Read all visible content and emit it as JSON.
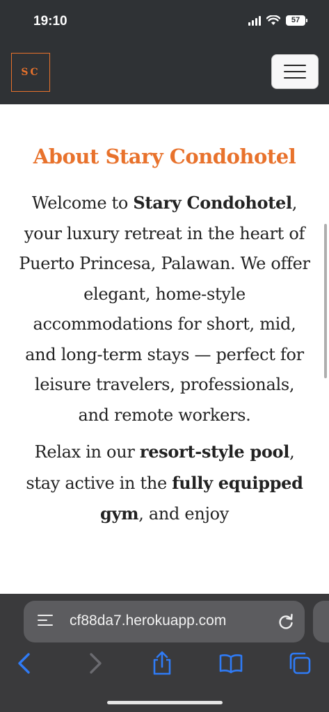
{
  "status_bar": {
    "time": "19:10",
    "battery": "57"
  },
  "navbar": {
    "logo_text": "SC"
  },
  "content": {
    "title": "About Stary Condohotel",
    "para1": {
      "p1": "Welcome to ",
      "b1": "Stary Condohotel",
      "p2": ", your luxury retreat in the heart of Puerto Princesa, Palawan. We offer elegant, home-style accommodations for short, mid, and long-term stays — perfect for leisure travelers, professionals, and remote workers."
    },
    "para2": {
      "p1": "Relax in our ",
      "b1": "resort-style pool",
      "p2": ", stay active in the ",
      "b2": "fully equipped gym",
      "p3": ", and enjoy"
    }
  },
  "browser": {
    "url": "cf88da7.herokuapp.com"
  },
  "colors": {
    "accent": "#e8722c",
    "nav_bg": "#2f3235",
    "toolbar_icon": "#2f7bf6"
  },
  "icons": [
    "reader-icon",
    "reload-icon",
    "back-icon",
    "forward-icon",
    "share-icon",
    "bookmarks-icon",
    "tabs-icon",
    "menu-icon"
  ]
}
